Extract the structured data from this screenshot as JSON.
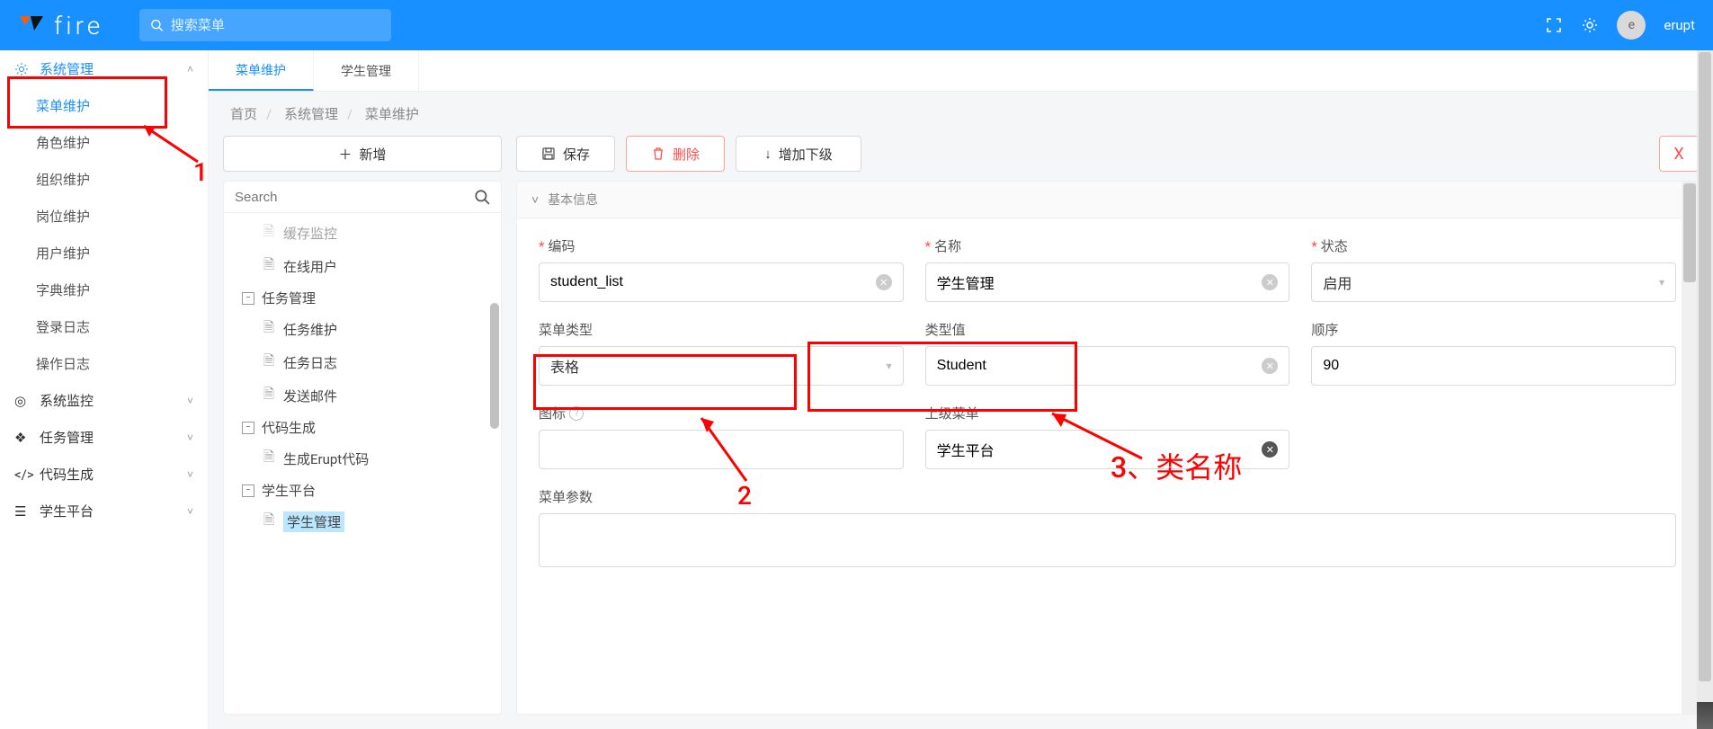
{
  "header": {
    "app_name": "fire",
    "search_placeholder": "搜索菜单",
    "user_initial": "e",
    "username": "erupt"
  },
  "sidebar": {
    "groups": [
      {
        "icon": "gear",
        "label": "系统管理",
        "expanded": true,
        "active": true,
        "items": [
          "菜单维护",
          "角色维护",
          "组织维护",
          "岗位维护",
          "用户维护",
          "字典维护",
          "登录日志",
          "操作日志"
        ]
      },
      {
        "icon": "target",
        "label": "系统监控",
        "expanded": false
      },
      {
        "icon": "cubes",
        "label": "任务管理",
        "expanded": false
      },
      {
        "icon": "code",
        "label": "代码生成",
        "expanded": false
      },
      {
        "icon": "list",
        "label": "学生平台",
        "expanded": false
      }
    ]
  },
  "tabs": [
    {
      "label": "菜单维护",
      "active": true
    },
    {
      "label": "学生管理",
      "active": false
    }
  ],
  "breadcrumb": [
    "首页",
    "系统管理",
    "菜单维护"
  ],
  "leftPanel": {
    "add_btn": "新增",
    "search_placeholder": "Search",
    "tree": [
      {
        "level": 2,
        "type": "doc",
        "label": "缓存监控",
        "cut": true
      },
      {
        "level": 2,
        "type": "doc",
        "label": "在线用户"
      },
      {
        "level": 1,
        "type": "tog",
        "open": true,
        "label": "任务管理"
      },
      {
        "level": 2,
        "type": "doc",
        "label": "任务维护"
      },
      {
        "level": 2,
        "type": "doc",
        "label": "任务日志"
      },
      {
        "level": 2,
        "type": "doc",
        "label": "发送邮件"
      },
      {
        "level": 1,
        "type": "tog",
        "open": true,
        "label": "代码生成"
      },
      {
        "level": 2,
        "type": "doc",
        "label": "生成Erupt代码"
      },
      {
        "level": 1,
        "type": "tog",
        "open": true,
        "label": "学生平台"
      },
      {
        "level": 2,
        "type": "doc",
        "label": "学生管理",
        "selected": true
      }
    ]
  },
  "toolbar": {
    "save": "保存",
    "delete": "删除",
    "add_child": "增加下级",
    "close": "X"
  },
  "section_title": "基本信息",
  "form": {
    "code": {
      "label": "编码",
      "value": "student_list",
      "required": true
    },
    "name": {
      "label": "名称",
      "value": "学生管理",
      "required": true
    },
    "status": {
      "label": "状态",
      "value": "启用",
      "required": true
    },
    "menu_type": {
      "label": "菜单类型",
      "value": "表格"
    },
    "type_value": {
      "label": "类型值",
      "value": "Student"
    },
    "order": {
      "label": "顺序",
      "value": "90"
    },
    "icon": {
      "label": "图标"
    },
    "parent": {
      "label": "上级菜单",
      "value": "学生平台"
    },
    "params": {
      "label": "菜单参数"
    }
  },
  "annotations": {
    "a1": "1",
    "a2": "2",
    "a3": "3、类名称"
  }
}
